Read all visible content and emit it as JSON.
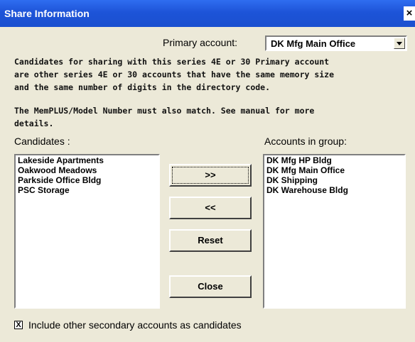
{
  "window": {
    "title": "Share Information",
    "close_glyph": "×"
  },
  "primary": {
    "label": "Primary account:",
    "value": "DK Mfg Main Office"
  },
  "description": [
    "Candidates for sharing with this series 4E or 30 Primary account",
    "are other series 4E or 30 accounts that have the same memory size",
    "and the same number of digits in the directory code."
  ],
  "note": [
    "The MemPLUS/Model Number must also match. See manual for more",
    "details."
  ],
  "candidates": {
    "label": "Candidates :",
    "items": [
      "Lakeside Apartments",
      "Oakwood Meadows",
      "Parkside Office Bldg",
      "PSC Storage"
    ]
  },
  "group": {
    "label": "Accounts in group:",
    "items": [
      "DK Mfg HP Bldg",
      "DK Mfg Main Office",
      "DK Shipping",
      "DK Warehouse Bldg"
    ]
  },
  "buttons": {
    "add": ">>",
    "remove": "<<",
    "reset": "Reset",
    "close": "Close"
  },
  "option": {
    "checked_glyph": "X",
    "label": "Include other secondary accounts as candidates"
  }
}
